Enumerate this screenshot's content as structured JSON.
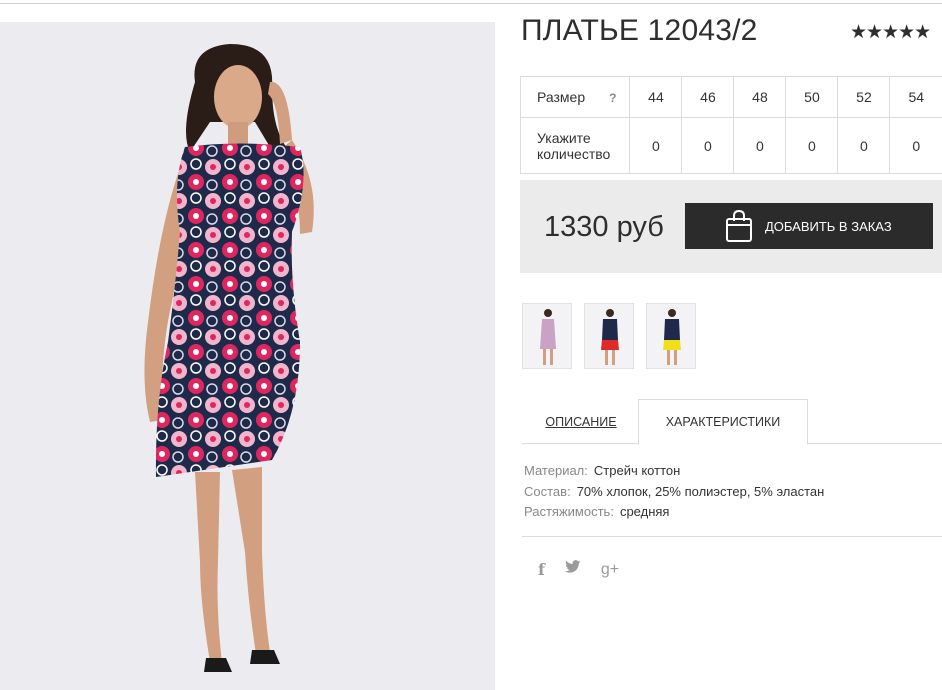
{
  "product": {
    "title": "ПЛАТЬЕ 12043/2",
    "rating_stars": "★★★★★"
  },
  "size_table": {
    "size_label": "Размер",
    "help_mark": "?",
    "quantity_label": "Укажите количество",
    "sizes": [
      "44",
      "46",
      "48",
      "50",
      "52",
      "54"
    ],
    "quantities": [
      "0",
      "0",
      "0",
      "0",
      "0",
      "0"
    ]
  },
  "purchase": {
    "price": "1330 руб",
    "add_button_label": "ДОБАВИТЬ В ЗАКАЗ",
    "button_icon": "shopping-bag-icon"
  },
  "thumbnails": [
    {
      "name": "thumb-floral-dress"
    },
    {
      "name": "thumb-navy-red-dress"
    },
    {
      "name": "thumb-navy-yellow-dress"
    }
  ],
  "tabs": {
    "description": "ОПИСАНИЕ",
    "characteristics": "ХАРАКТЕРИСТИКИ",
    "active": "characteristics"
  },
  "specs": [
    {
      "key": "Материал:",
      "value": "Стрейч коттон"
    },
    {
      "key": "Состав:",
      "value": "70% хлопок, 25% полиэстер, 5% эластан"
    },
    {
      "key": "Растяжимость:",
      "value": "средняя"
    }
  ],
  "social": {
    "facebook": "f",
    "twitter": "🐦",
    "googleplus": "g+"
  },
  "colors": {
    "dark": "#2b2b2b",
    "price_box_bg": "#ebebeb",
    "dress_navy": "#1f2a4a",
    "dress_pink": "#e0265f"
  }
}
